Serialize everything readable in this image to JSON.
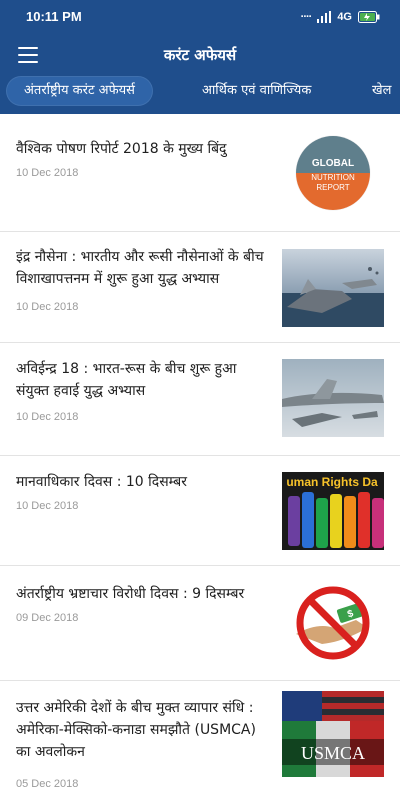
{
  "status_bar": {
    "time": "10:11 PM",
    "network": "4G"
  },
  "toolbar": {
    "title": "करंट अफेयर्स"
  },
  "tabs": [
    {
      "label": "अंतर्राष्ट्रीय करंट अफेयर्स"
    },
    {
      "label": "आर्थिक एवं वाणिज्यिक"
    },
    {
      "label": "खेल"
    }
  ],
  "articles": [
    {
      "title": "वैश्विक पोषण रिपोर्ट 2018 के मुख्य बिंदु",
      "date": "10 Dec 2018",
      "thumb": {
        "l1": "GLOBAL",
        "l2": "NUTRITION",
        "l3": "REPORT"
      }
    },
    {
      "title": "इंद्र नौसेना : भारतीय और रूसी नौसेनाओं के बीच विशाखापत्तनम में शुरू हुआ युद्ध अभ्यास",
      "date": "10 Dec 2018"
    },
    {
      "title": "अविईन्द्र 18 : भारत-रूस के बीच शुरू हुआ संयुक्त हवाई युद्ध अभ्यास",
      "date": "10 Dec 2018"
    },
    {
      "title": "मानवाधिकार दिवस : 10 दिसम्बर",
      "date": "10 Dec 2018",
      "thumb": {
        "l1": "uman Rights Da"
      }
    },
    {
      "title": "अंतर्राष्ट्रीय भ्रष्टाचार विरोधी दिवस : 9 दिसम्बर",
      "date": "09 Dec 2018",
      "thumb": {
        "l1": "$"
      }
    },
    {
      "title": "उत्तर अमेरिकी देशों के बीच मुक्त व्यापार संधि : अमेरिका-मेक्सिको-कनाडा समझौते (USMCA) का अवलोकन",
      "date": "05 Dec 2018",
      "thumb": {
        "l1": "USMCA"
      }
    }
  ]
}
